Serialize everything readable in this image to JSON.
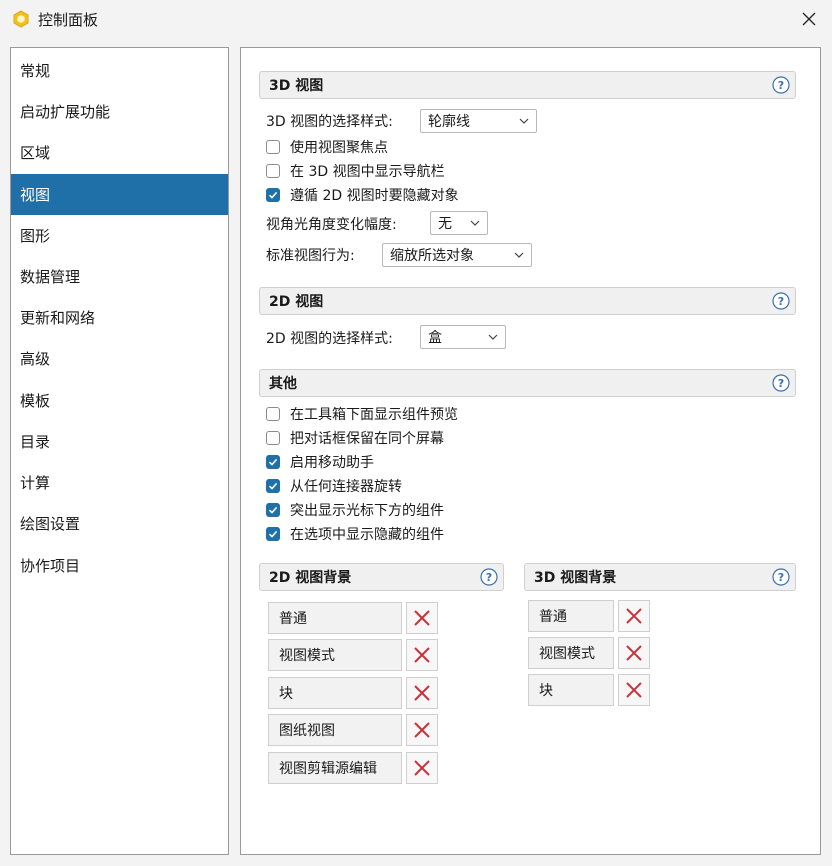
{
  "window": {
    "title": "控制面板"
  },
  "sidebar": {
    "items": [
      {
        "label": "常规"
      },
      {
        "label": "启动扩展功能"
      },
      {
        "label": "区域"
      },
      {
        "label": "视图",
        "active": true
      },
      {
        "label": "图形"
      },
      {
        "label": "数据管理"
      },
      {
        "label": "更新和网络"
      },
      {
        "label": "高级"
      },
      {
        "label": "模板"
      },
      {
        "label": "目录"
      },
      {
        "label": "计算"
      },
      {
        "label": "绘图设置"
      },
      {
        "label": "协作项目"
      }
    ]
  },
  "view3d": {
    "title": "3D 视图",
    "selection_style_label": "3D 视图的选择样式:",
    "selection_style_value": "轮廓线",
    "use_focus": {
      "label": "使用视图聚焦点",
      "checked": false
    },
    "show_navbar": {
      "label": "在 3D 视图中显示导航栏",
      "checked": false
    },
    "follow_2d_hidden": {
      "label": "遵循 2D 视图时要隐藏对象",
      "checked": true
    },
    "fov_label": "视角光角度变化幅度:",
    "fov_value": "无",
    "std_behavior_label": "标准视图行为:",
    "std_behavior_value": "缩放所选对象"
  },
  "view2d": {
    "title": "2D 视图",
    "selection_style_label": "2D 视图的选择样式:",
    "selection_style_value": "盒"
  },
  "other": {
    "title": "其他",
    "options": [
      {
        "label": "在工具箱下面显示组件预览",
        "checked": false
      },
      {
        "label": "把对话框保留在同个屏幕",
        "checked": false
      },
      {
        "label": "启用移动助手",
        "checked": true
      },
      {
        "label": "从任何连接器旋转",
        "checked": true
      },
      {
        "label": "突出显示光标下方的组件",
        "checked": true
      },
      {
        "label": "在选项中显示隐藏的组件",
        "checked": true
      }
    ]
  },
  "bg2d": {
    "title": "2D 视图背景",
    "items": [
      {
        "label": "普通"
      },
      {
        "label": "视图模式"
      },
      {
        "label": "块"
      },
      {
        "label": "图纸视图"
      },
      {
        "label": "视图剪辑源编辑"
      }
    ]
  },
  "bg3d": {
    "title": "3D 视图背景",
    "items": [
      {
        "label": "普通"
      },
      {
        "label": "视图模式"
      },
      {
        "label": "块"
      }
    ]
  },
  "colors": {
    "accent": "#1f6fa8",
    "delete_x": "#c8323c",
    "help": "#3a6fb0",
    "app_icon": "#f2c21b"
  }
}
